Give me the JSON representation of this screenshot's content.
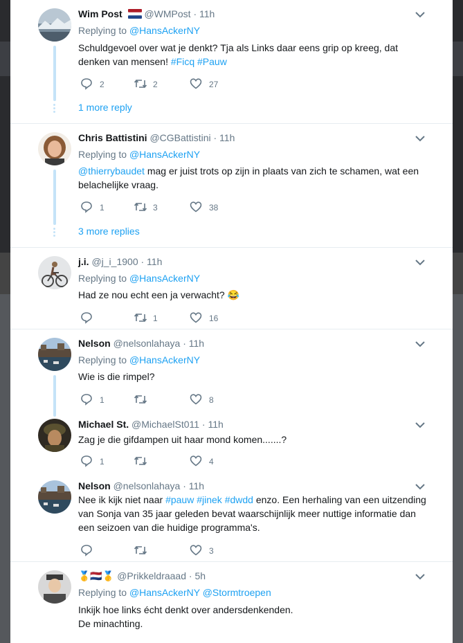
{
  "tweets": [
    {
      "name": "Wim Post",
      "handle": "@WMPost",
      "time": "· 11h",
      "replying_label": "Replying to",
      "replying_to": "@HansAckerNY",
      "text_part1": "Schuldgevoel over wat je denkt? Tja als Links daar eens grip op kreeg, dat denken van mensen! ",
      "hashtag1": "#Ficq",
      "hashtag2": "#Pauw",
      "replies": "2",
      "retweets": "2",
      "likes": "27",
      "more_link": "1 more reply"
    },
    {
      "name": "Chris Battistini",
      "handle": "@CGBattistini",
      "time": "· 11h",
      "replying_label": "Replying to",
      "replying_to": "@HansAckerNY",
      "mention": "@thierrybaudet",
      "text": " mag er juist trots op zijn in plaats van zich te schamen, wat een belachelijke vraag.",
      "replies": "1",
      "retweets": "3",
      "likes": "38",
      "more_link": "3 more replies"
    },
    {
      "name": "j.i.",
      "handle": "@j_i_1900",
      "time": "· 11h",
      "replying_label": "Replying to",
      "replying_to": "@HansAckerNY",
      "text": "Had ze nou echt een ja verwacht? 😂",
      "replies": "",
      "retweets": "1",
      "likes": "16"
    },
    {
      "name": "Nelson",
      "handle": "@nelsonlahaya",
      "time": "· 11h",
      "replying_label": "Replying to",
      "replying_to": "@HansAckerNY",
      "text": "Wie is die rimpel?",
      "replies": "1",
      "retweets": "",
      "likes": "8"
    },
    {
      "name": "Michael St.",
      "handle": "@MichaelSt011",
      "time": "· 11h",
      "text": "Zag je die gifdampen uit haar mond komen.......?",
      "replies": "1",
      "retweets": "",
      "likes": "4"
    },
    {
      "name": "Nelson",
      "handle": "@nelsonlahaya",
      "time": "· 11h",
      "text_part1": "Nee ik kijk niet naar ",
      "hashtag1": "#pauw",
      "hashtag2": "#jinek",
      "hashtag3": "#dwdd",
      "text_part2": " enzo. Een herhaling van een uitzending van Sonja van 35 jaar geleden bevat waarschijnlijk meer nuttige informatie dan een seizoen van die huidige programma's.",
      "replies": "",
      "retweets": "",
      "likes": "3"
    },
    {
      "name_emoji": "🥇🇳🇱🥇",
      "handle": "@Prikkeldraaad",
      "time": "· 5h",
      "replying_label": "Replying to",
      "replying_to": "@HansAckerNY",
      "replying_to2": "@Stormtroepen",
      "text_line1": "Inkijk hoe links écht denkt over andersdenkenden.",
      "text_line2": "De minachting."
    }
  ],
  "colors": {
    "link": "#1da1f2",
    "text": "#14171a",
    "muted": "#657786",
    "thread": "#c4e3f8",
    "backdrop": "#1b1c1e"
  },
  "icons": [
    "reply-icon",
    "retweet-icon",
    "like-icon",
    "chevron-down-icon",
    "netherlands-flag-icon"
  ]
}
